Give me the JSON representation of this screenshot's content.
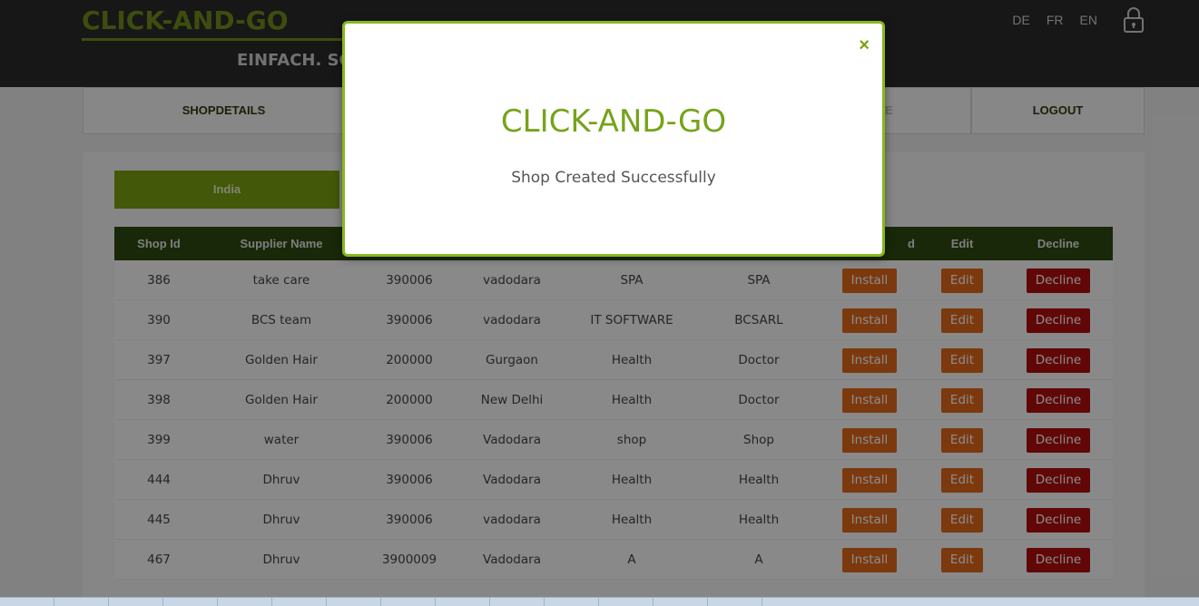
{
  "header": {
    "logo": "CLICK-AND-GO",
    "tagline": "EINFACH. SC",
    "languages": [
      "DE",
      "FR",
      "EN"
    ],
    "lock_icon": "lock-icon"
  },
  "nav": {
    "items": [
      "SHOPDETAILS",
      "E",
      "LOGOUT"
    ]
  },
  "country_tab": "India",
  "table": {
    "columns": [
      "Shop Id",
      "Supplier Name",
      "",
      "",
      "",
      "",
      "d",
      "Edit",
      "Decline"
    ],
    "rows": [
      {
        "id": "386",
        "supplier": "take care",
        "pin": "390006",
        "city": "vadodara",
        "category": "SPA",
        "type": "SPA",
        "install": "Install",
        "edit": "Edit",
        "decline": "Decline"
      },
      {
        "id": "390",
        "supplier": "BCS team",
        "pin": "390006",
        "city": "vadodara",
        "category": "IT SOFTWARE",
        "type": "BCSARL",
        "install": "Install",
        "edit": "Edit",
        "decline": "Decline"
      },
      {
        "id": "397",
        "supplier": "Golden Hair",
        "pin": "200000",
        "city": "Gurgaon",
        "category": "Health",
        "type": "Doctor",
        "install": "Install",
        "edit": "Edit",
        "decline": "Decline"
      },
      {
        "id": "398",
        "supplier": "Golden Hair",
        "pin": "200000",
        "city": "New Delhi",
        "category": "Health",
        "type": "Doctor",
        "install": "Install",
        "edit": "Edit",
        "decline": "Decline"
      },
      {
        "id": "399",
        "supplier": "water",
        "pin": "390006",
        "city": "Vadodara",
        "category": "shop",
        "type": "Shop",
        "install": "Install",
        "edit": "Edit",
        "decline": "Decline"
      },
      {
        "id": "444",
        "supplier": "Dhruv",
        "pin": "390006",
        "city": "Vadodara",
        "category": "Health",
        "type": "Health",
        "install": "Install",
        "edit": "Edit",
        "decline": "Decline"
      },
      {
        "id": "445",
        "supplier": "Dhruv",
        "pin": "390006",
        "city": "vadodara",
        "category": "Health",
        "type": "Health",
        "install": "Install",
        "edit": "Edit",
        "decline": "Decline"
      },
      {
        "id": "467",
        "supplier": "Dhruv",
        "pin": "3900009",
        "city": "Vadodara",
        "category": "A",
        "type": "A",
        "install": "Install",
        "edit": "Edit",
        "decline": "Decline"
      }
    ]
  },
  "modal": {
    "title": "CLICK-AND-GO",
    "message": "Shop Created Successfully",
    "close": "×"
  },
  "colors": {
    "brand_green": "#76a31a",
    "install": "#e2691a",
    "decline": "#b10d0d",
    "table_header": "#2e4a10"
  }
}
